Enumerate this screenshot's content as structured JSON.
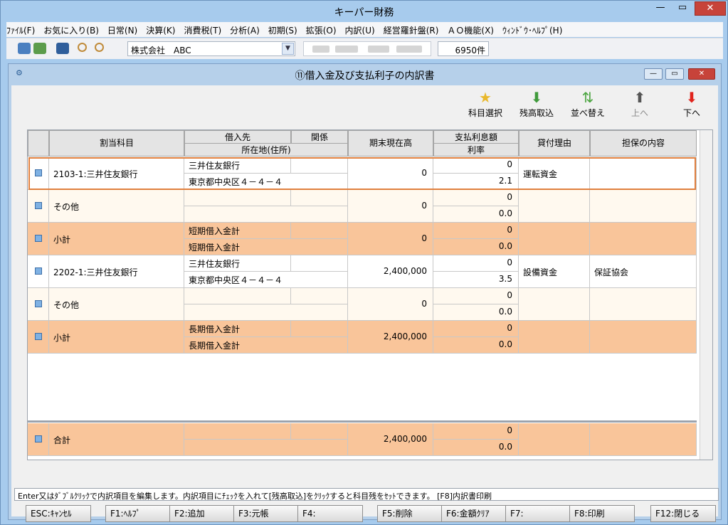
{
  "window": {
    "title": "キーパー財務"
  },
  "menu": [
    "ﾌｧｲﾙ(F)",
    "お気に入り(B)",
    "日常(N)",
    "決算(K)",
    "消費税(T)",
    "分析(A)",
    "初期(S)",
    "拡張(O)",
    "内訳(U)",
    "経営羅針盤(R)",
    "ＡＯ機能(X)",
    "ｳｨﾝﾄﾞｳ･ﾍﾙﾌﾟ(H)"
  ],
  "toolbar": {
    "company": "株式会社　ABC",
    "count": "6950件"
  },
  "inner": {
    "title": "⑪借入金及び支払利子の内訳書"
  },
  "tools": [
    {
      "label": "科目選択",
      "icon": "star-icon"
    },
    {
      "label": "残高取込",
      "icon": "import-icon"
    },
    {
      "label": "並べ替え",
      "icon": "sort-icon"
    },
    {
      "label": "上へ",
      "icon": "arrow-up-icon"
    },
    {
      "label": "下へ",
      "icon": "arrow-down-icon"
    }
  ],
  "headers": {
    "account": "割当科目",
    "lender": "借入先",
    "relation": "関係",
    "address": "所在地(住所)",
    "balance": "期末現在高",
    "interest": "支払利息額",
    "rate": "利率",
    "reason": "貸付理由",
    "collateral": "担保の内容"
  },
  "rows": [
    {
      "account": "2103-1:三井住友銀行",
      "lender": "三井住友銀行",
      "relation": "",
      "address": "東京都中央区４－４－４",
      "balance": "0",
      "interest": "0",
      "rate": "2.1",
      "reason": "運転資金",
      "collateral": "",
      "style": "white"
    },
    {
      "account": "その他",
      "lender": "",
      "relation": "",
      "address": "",
      "balance": "0",
      "interest": "0",
      "rate": "0.0",
      "reason": "",
      "collateral": "",
      "style": "cream"
    },
    {
      "account": "小計",
      "lender": "短期借入金計",
      "relation": "",
      "address": "短期借入金計",
      "balance": "0",
      "interest": "0",
      "rate": "0.0",
      "reason": "",
      "collateral": "",
      "style": "orange"
    },
    {
      "account": "2202-1:三井住友銀行",
      "lender": "三井住友銀行",
      "relation": "",
      "address": "東京都中央区４－４－４",
      "balance": "2,400,000",
      "interest": "0",
      "rate": "3.5",
      "reason": "設備資金",
      "collateral": "保証協会",
      "style": "white"
    },
    {
      "account": "その他",
      "lender": "",
      "relation": "",
      "address": "",
      "balance": "0",
      "interest": "0",
      "rate": "0.0",
      "reason": "",
      "collateral": "",
      "style": "cream"
    },
    {
      "account": "小計",
      "lender": "長期借入金計",
      "relation": "",
      "address": "長期借入金計",
      "balance": "2,400,000",
      "interest": "0",
      "rate": "0.0",
      "reason": "",
      "collateral": "",
      "style": "orange"
    }
  ],
  "total": {
    "account": "合計",
    "balance": "2,400,000",
    "interest": "0",
    "rate": "0.0"
  },
  "status": "Enter又はﾀﾞﾌﾞﾙｸﾘｯｸで内訳項目を編集します。内訳項目にﾁｪｯｸを入れて[残高取込]をｸﾘｯｸすると科目残をｾｯﾄできます。 [F8]内訳書印刷",
  "fkeys": [
    "ESC:ｷｬﾝｾﾙ",
    "F1:ﾍﾙﾌﾟ",
    "F2:追加",
    "F3:元帳",
    "F4:",
    "F5:削除",
    "F6:金額ｸﾘｱ",
    "F7:",
    "F8:印刷",
    "F12:閉じる"
  ]
}
